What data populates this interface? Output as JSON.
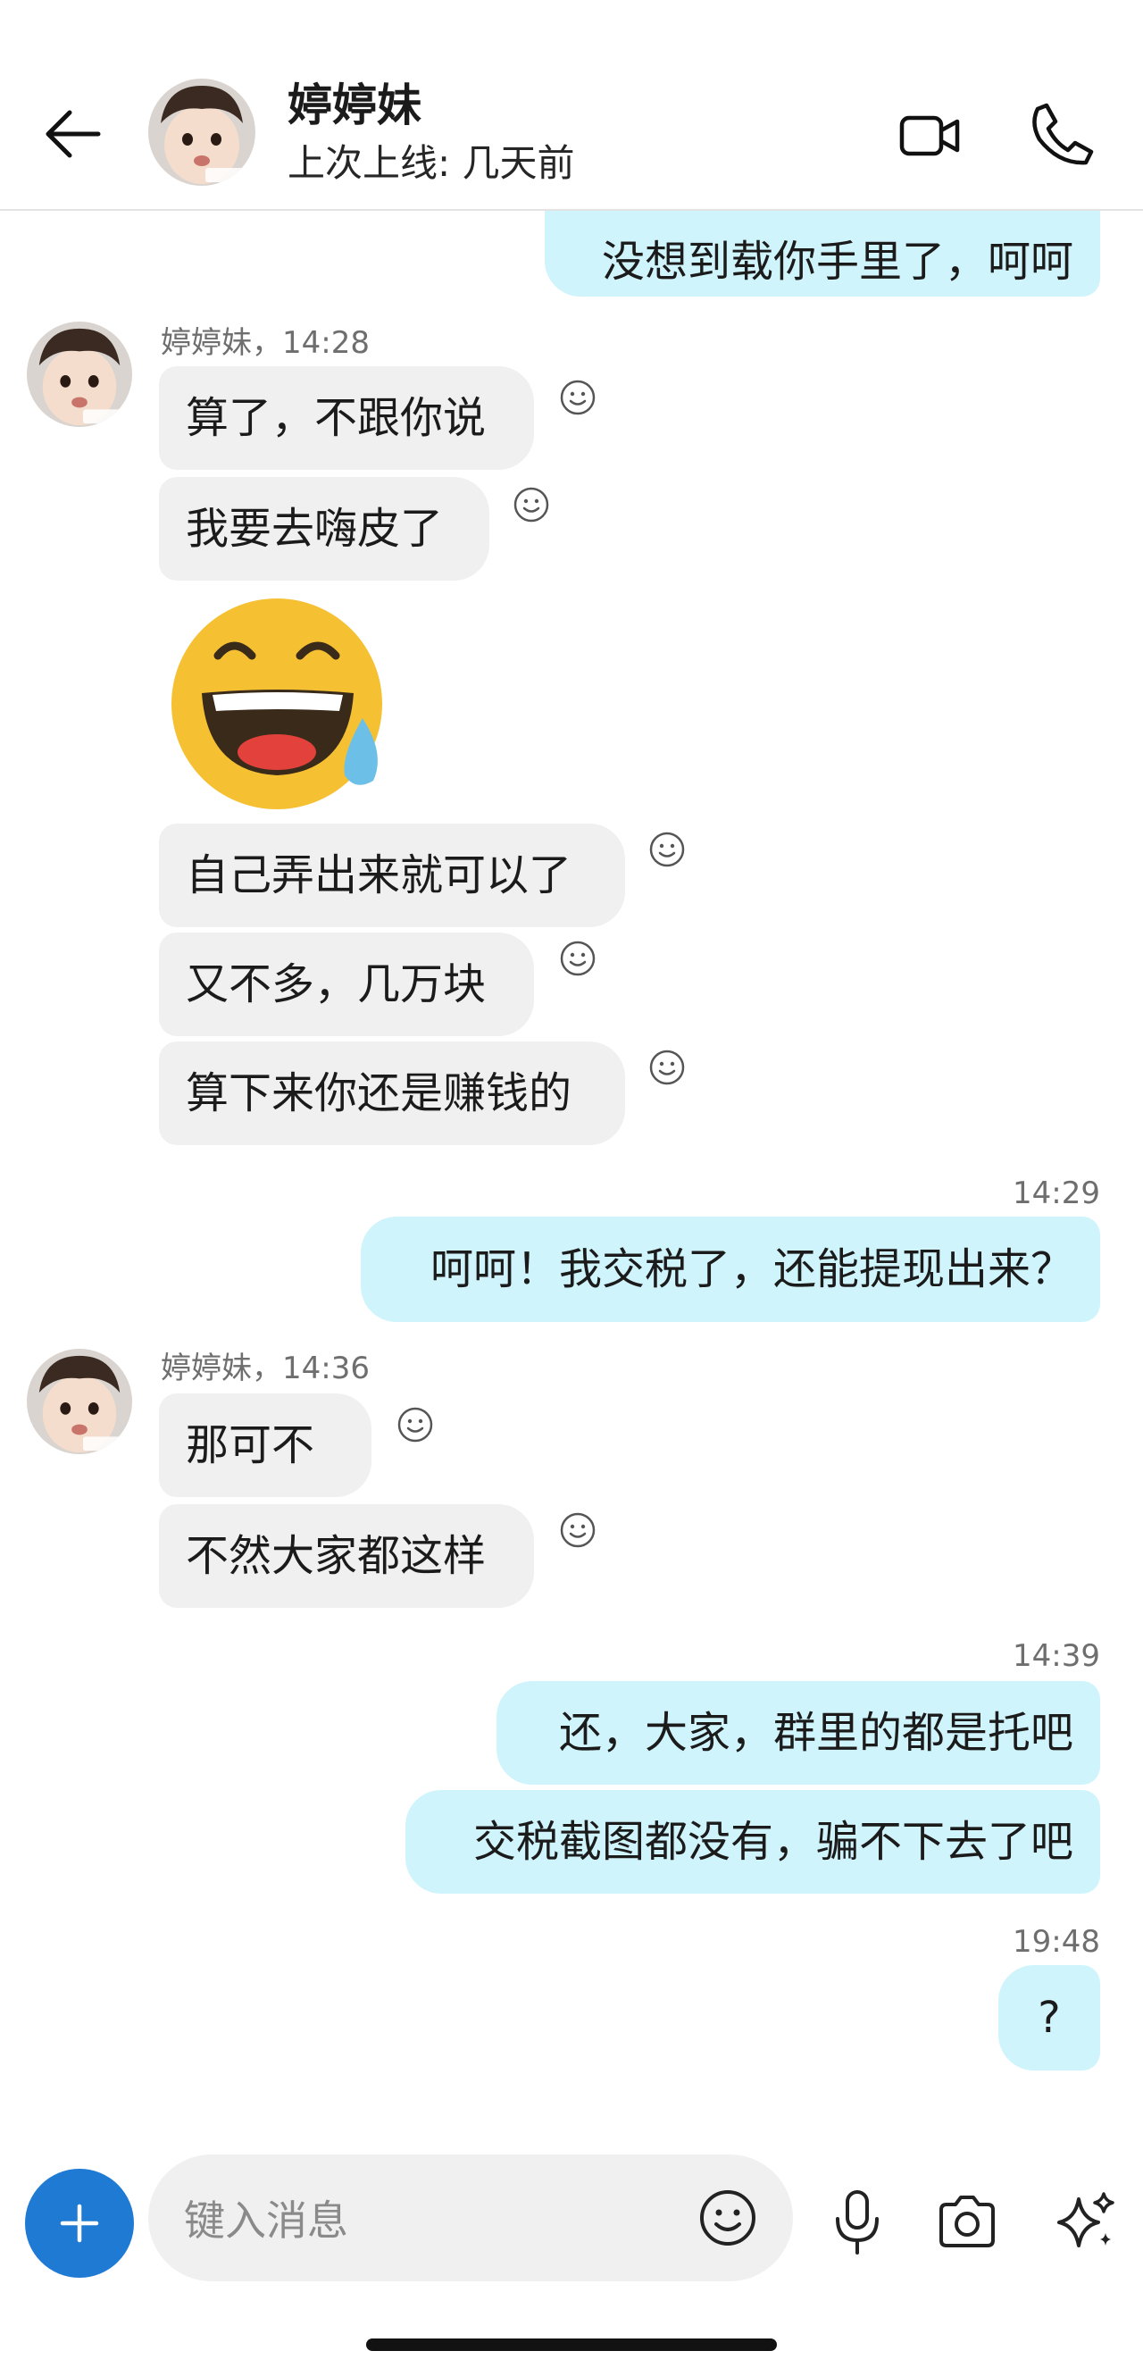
{
  "header": {
    "contact_name": "婷婷妹",
    "status": "上次上线: 几天前"
  },
  "messages": {
    "m0": "没想到载你手里了，呵呵",
    "sender1": "婷婷妹，14:28",
    "m1": "算了，不跟你说",
    "m2": "我要去嗨皮了",
    "m3": "自己弄出来就可以了",
    "m4": "又不多，几万块",
    "m5": "算下来你还是赚钱的",
    "time1": "14:29",
    "m6": "呵呵！我交税了，还能提现出来？",
    "sender2": "婷婷妹，14:36",
    "m7": "那可不",
    "m8": "不然大家都这样",
    "time2": "14:39",
    "m9": "还，大家，群里的都是托吧",
    "m10": "交税截图都没有，骗不下去了吧",
    "time3": "19:48",
    "m11": "?"
  },
  "composer": {
    "placeholder": "键入消息"
  },
  "icons": {
    "back": "arrow-left-icon",
    "video": "video-camera-icon",
    "call": "phone-icon",
    "react": "smiley-reaction-icon",
    "sticker": "grinning-sweat-emoji",
    "add": "plus-icon",
    "emoji": "emoji-icon",
    "mic": "microphone-icon",
    "camera": "camera-icon",
    "sparkle": "sparkle-icon"
  },
  "colors": {
    "outgoing_bubble": "#d0f4fb",
    "incoming_bubble": "#f0f0f0",
    "accent": "#1f7ad4"
  }
}
